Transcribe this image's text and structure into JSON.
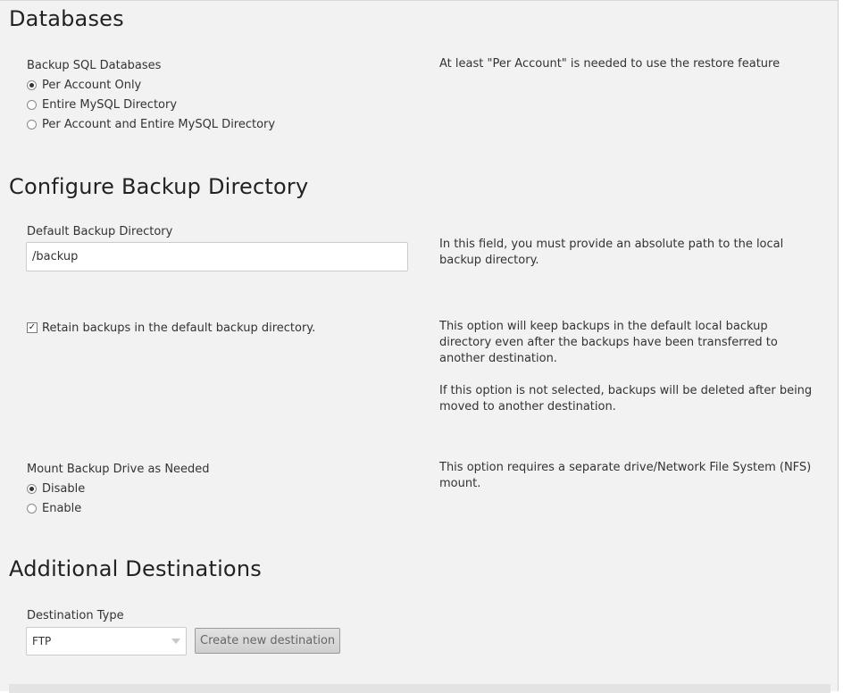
{
  "databases": {
    "heading": "Databases",
    "field_label": "Backup SQL Databases",
    "options": [
      "Per Account Only",
      "Entire MySQL Directory",
      "Per Account and Entire MySQL Directory"
    ],
    "selected_index": 0,
    "help": "At least \"Per Account\" is needed to use the restore feature"
  },
  "backup_dir": {
    "heading": "Configure Backup Directory",
    "default_label": "Default Backup Directory",
    "default_value": "/backup",
    "default_help": "In this field, you must provide an absolute path to the local backup directory.",
    "retain_label": "Retain backups in the default backup directory.",
    "retain_checked": true,
    "retain_help_1": "This option will keep backups in the default local backup directory even after the backups have been transferred to another destination.",
    "retain_help_2": "If this option is not selected, backups will be deleted after being moved to another destination.",
    "mount_label": "Mount Backup Drive as Needed",
    "mount_options": [
      "Disable",
      "Enable"
    ],
    "mount_selected_index": 0,
    "mount_help": "This option requires a separate drive/Network File System (NFS) mount."
  },
  "destinations": {
    "heading": "Additional Destinations",
    "type_label": "Destination Type",
    "type_value": "FTP",
    "create_button": "Create new destination"
  }
}
